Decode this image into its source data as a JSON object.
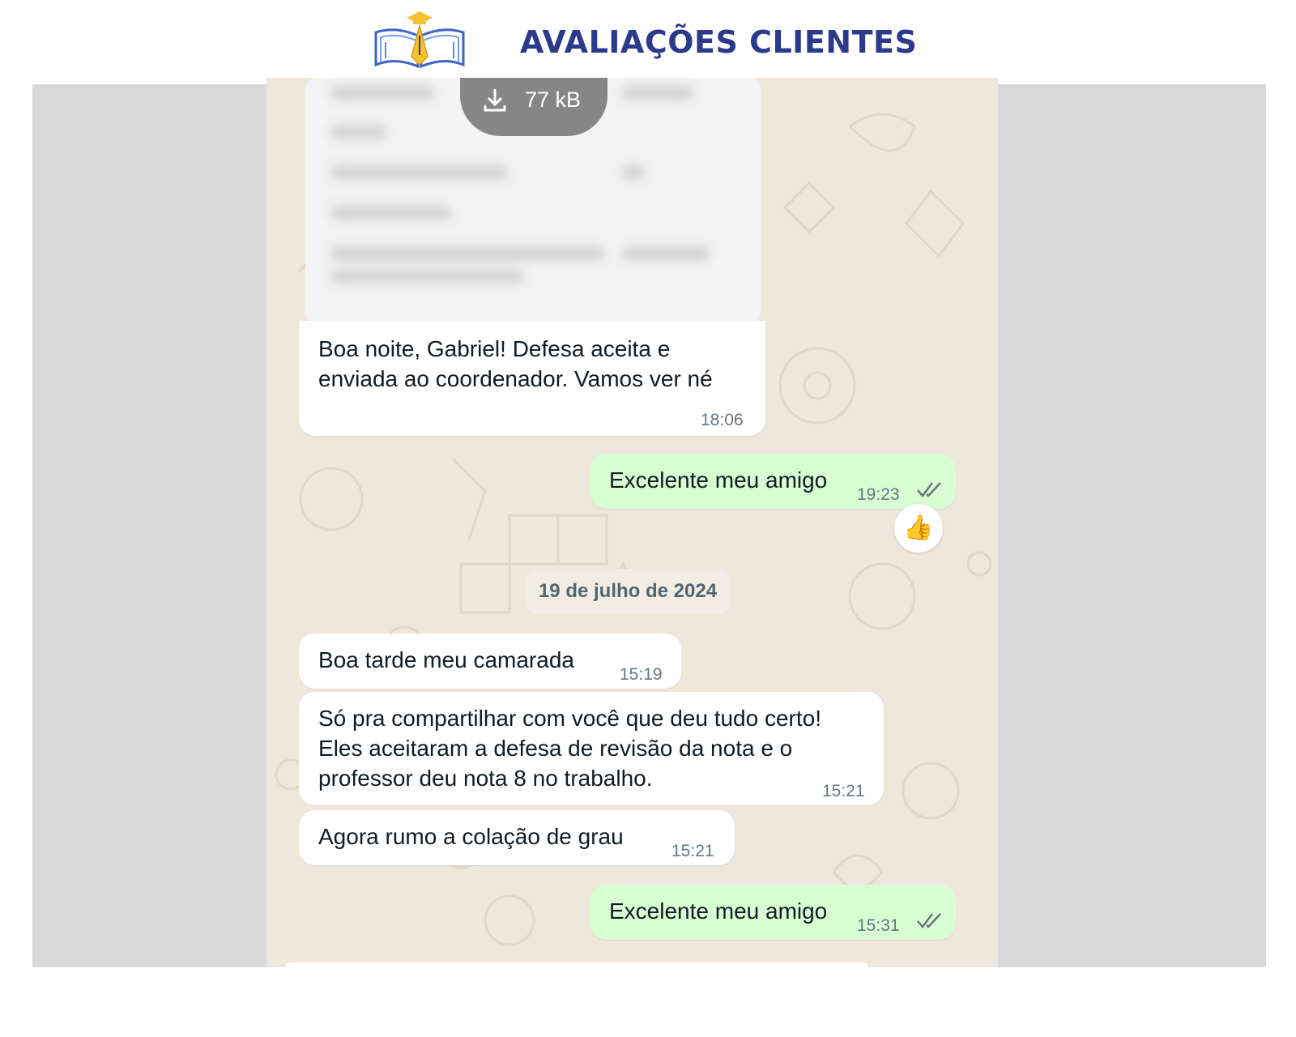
{
  "header": {
    "title": "AVALIAÇÕES CLIENTES",
    "logo": "book-pen-graduation-cap-logo",
    "title_color": "#2d3a8c"
  },
  "chat": {
    "document": {
      "icon": "download-icon",
      "size": "77 kB"
    },
    "messages": [
      {
        "direction": "incoming",
        "lines": [
          "Boa noite, Gabriel! Defesa aceita e",
          "enviada ao coordenador. Vamos ver né"
        ],
        "time": "18:06"
      },
      {
        "direction": "outgoing",
        "text": "Excelente meu amigo",
        "time": "19:23",
        "status": "read-ticks-icon",
        "reaction": "👍"
      },
      {
        "date_separator": "19 de julho de 2024"
      },
      {
        "direction": "incoming",
        "text": "Boa tarde meu camarada",
        "time": "15:19"
      },
      {
        "direction": "incoming",
        "lines": [
          "Só pra compartilhar com você que deu tudo certo!",
          "Eles aceitaram a defesa de revisão da nota e o",
          "professor deu nota 8 no trabalho."
        ],
        "time": "15:21"
      },
      {
        "direction": "incoming",
        "text": "Agora rumo a colação de grau",
        "time": "15:21"
      },
      {
        "direction": "outgoing",
        "text": "Excelente meu amigo",
        "time": "15:31",
        "status": "read-ticks-icon"
      }
    ],
    "colors": {
      "background": "#efe7dc",
      "incoming_bubble": "#ffffff",
      "outgoing_bubble": "#d9fdd3",
      "timestamp": "#667781",
      "panel": "#d9d9d9"
    }
  }
}
